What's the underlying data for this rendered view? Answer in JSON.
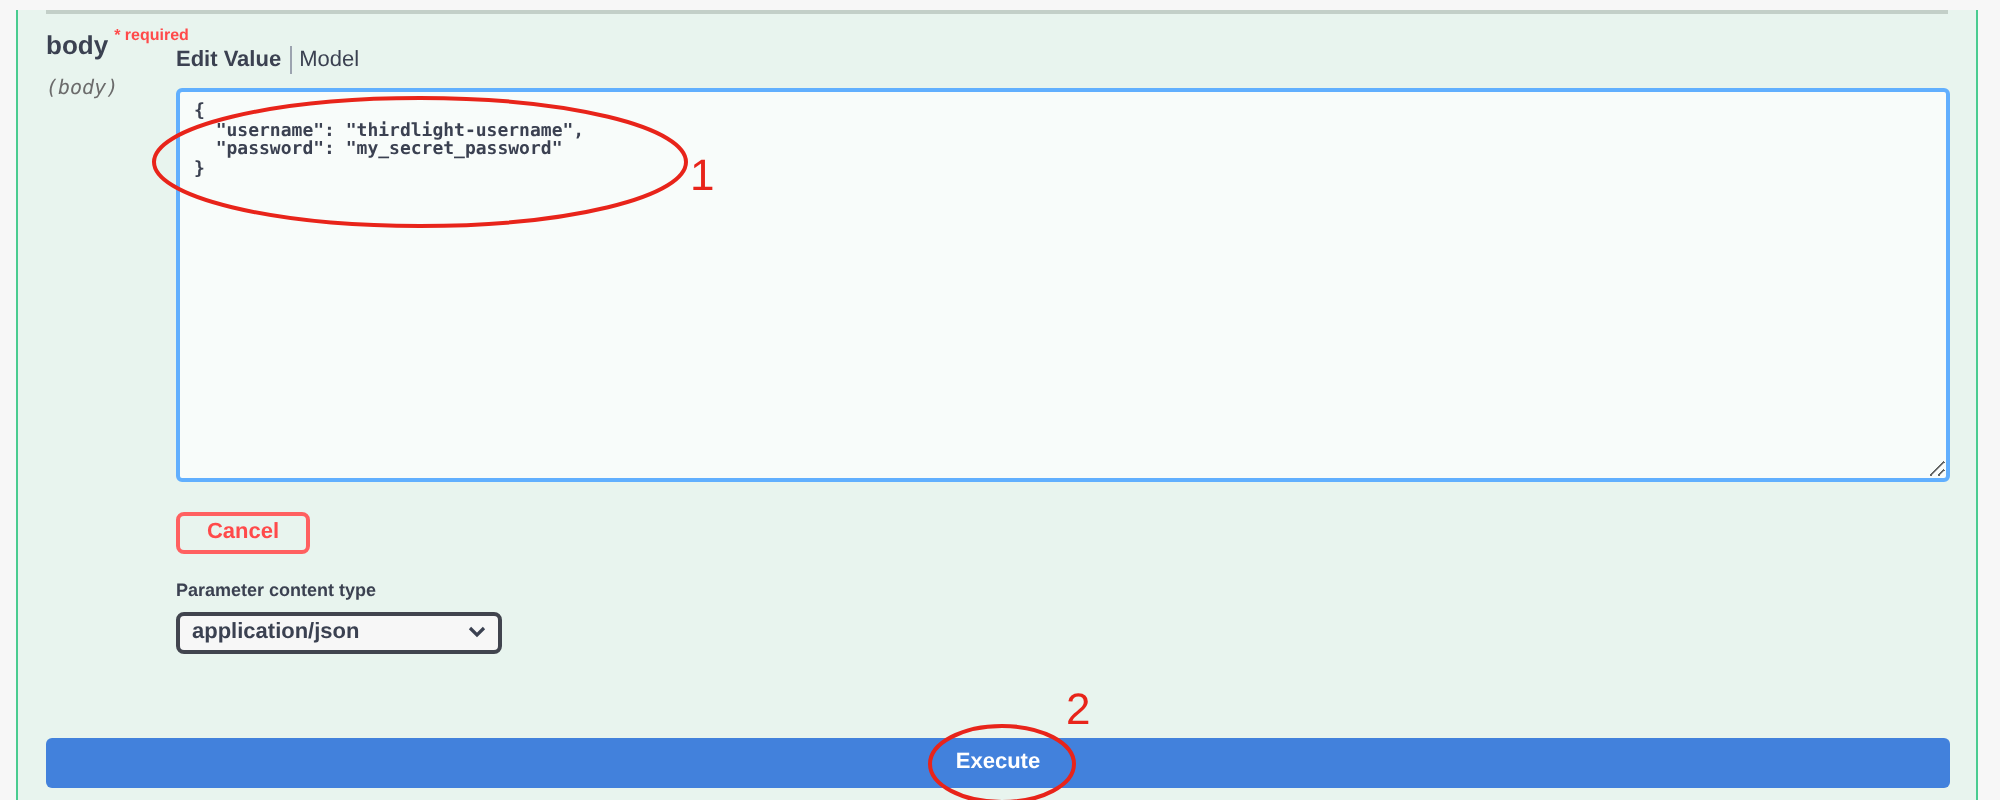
{
  "parameter": {
    "name": "body",
    "required_marker": "*",
    "required_label": "required",
    "location": "(body)"
  },
  "tabs": [
    {
      "label": "Edit Value",
      "selected": true
    },
    {
      "label": "Model",
      "selected": false
    }
  ],
  "editor": {
    "value": "{\n  \"username\": \"thirdlight-username\",\n  \"password\": \"my_secret_password\"\n}"
  },
  "cancel_button": "Cancel",
  "content_type": {
    "label": "Parameter content type",
    "value": "application/json"
  },
  "execute_button": "Execute",
  "annotations": [
    {
      "label": "1"
    },
    {
      "label": "2"
    }
  ]
}
